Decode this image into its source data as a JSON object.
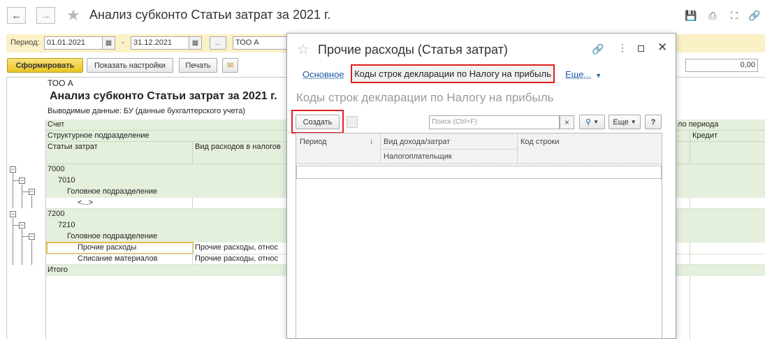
{
  "window": {
    "title": "Анализ субконто Статьи затрат  за 2021 г.",
    "icons": [
      "back-arrow-icon",
      "forward-arrow-icon",
      "star-icon",
      "save-icon",
      "print-icon",
      "preview-icon",
      "link-icon"
    ]
  },
  "filter": {
    "period_label": "Период:",
    "date_from": "01.01.2021",
    "dash": "-",
    "date_to": "31.12.2021",
    "ellipsis": "...",
    "org": "ТОО А"
  },
  "toolbar": {
    "generate": "Сформировать",
    "show_settings": "Показать настройки",
    "print": "Печать",
    "amount": "0,00"
  },
  "report": {
    "org": "ТОО А",
    "title": "Анализ субконто Статьи затрат  за 2021 г.",
    "output_data": "Выводимые данные:  БУ (данные бухгалтерского учета)",
    "header_account": "Счет",
    "header_division": "Структурное подразделение",
    "header_cost_items": "Статьи затрат",
    "header_expense_type": "Вид расходов в налогов",
    "header_start_period": "ло периода",
    "header_credit": "Кредит",
    "rows": {
      "r7000": "7000",
      "r7010": "7010",
      "head1": "Головное подразделение",
      "placeholder": "<...>",
      "r7200": "7200",
      "r7210": "7210",
      "head2": "Головное подразделение",
      "other_expenses": "Прочие расходы",
      "other_expenses_type": "Прочие расходы, относ",
      "write_off": "Списание материалов",
      "write_off_type": "Прочие расходы, относ",
      "total": "Итого"
    }
  },
  "dialog": {
    "title": "Прочие расходы (Статья затрат)",
    "tab_main": "Основное",
    "tab_active": "Коды строк декларации по Налогу на прибыль",
    "tab_more": "Еще...",
    "section_title": "Коды строк декларации по Налогу на прибыль",
    "create_button": "Создать",
    "search_placeholder": "Поиск (Ctrl+F)",
    "clear": "×",
    "more_button": "Еще",
    "help": "?",
    "columns": {
      "period": "Период",
      "income_type": "Вид дохода/затрат",
      "line_code": "Код строки",
      "taxpayer": "Налогоплательщик"
    }
  },
  "colors": {
    "highlight_red": "#e11d1d",
    "primary_button": "#eac522",
    "group_band": "#e4efdc",
    "link_blue": "#1c57a4"
  }
}
